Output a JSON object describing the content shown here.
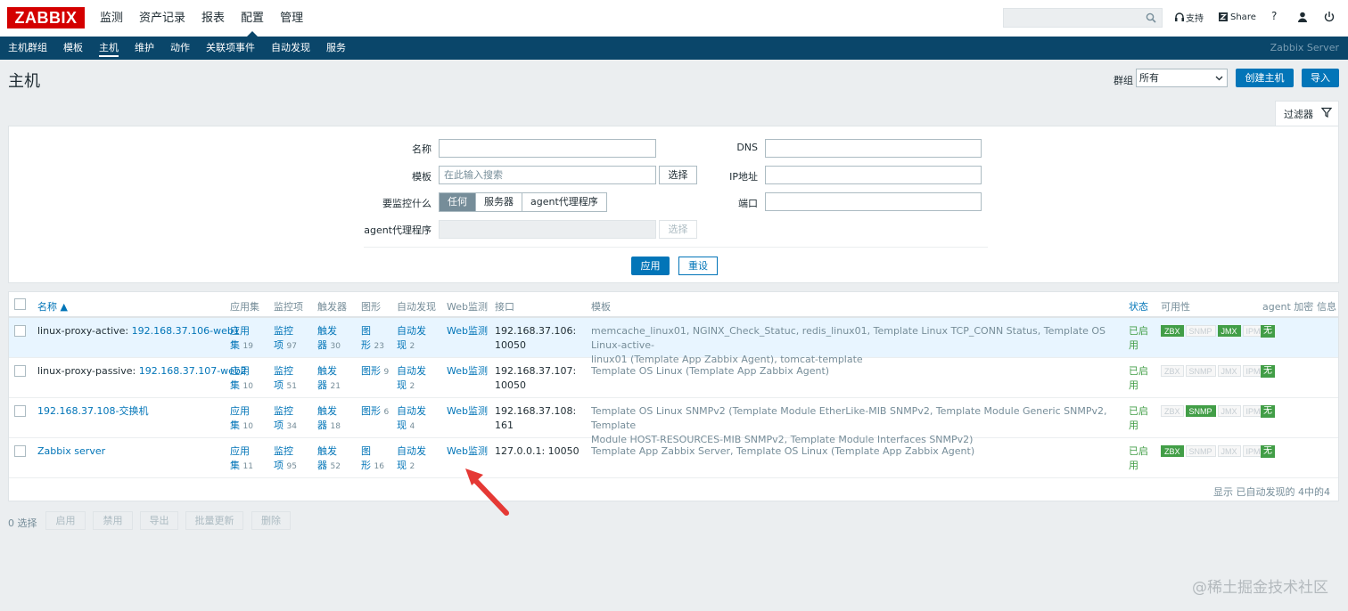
{
  "header": {
    "logo": "ZABBIX",
    "menu": [
      "监测",
      "资产记录",
      "报表",
      "配置",
      "管理"
    ],
    "active_menu": "配置",
    "search_value": "",
    "support": "支持",
    "share": "Share",
    "help": "?"
  },
  "submenu": {
    "items": [
      "主机群组",
      "模板",
      "主机",
      "维护",
      "动作",
      "关联项事件",
      "自动发现",
      "服务"
    ],
    "active": "主机",
    "server_name": "Zabbix Server"
  },
  "page": {
    "title": "主机",
    "group_label": "群组",
    "group_value": "所有",
    "create_button": "创建主机",
    "import_button": "导入"
  },
  "filter": {
    "tab_label": "过滤器",
    "name_label": "名称",
    "name_value": "",
    "template_label": "模板",
    "template_placeholder": "在此输入搜索",
    "select_button": "选择",
    "monitored_by_label": "要监控什么",
    "monitored_options": [
      "任何",
      "服务器",
      "agent代理程序"
    ],
    "monitored_selected": "任何",
    "proxy_label": "agent代理程序",
    "proxy_select_button": "选择",
    "dns_label": "DNS",
    "dns_value": "",
    "ip_label": "IP地址",
    "ip_value": "",
    "port_label": "端口",
    "port_value": "",
    "apply_button": "应用",
    "reset_button": "重设"
  },
  "table": {
    "columns": {
      "name": "名称 ▲",
      "applications": "应用集",
      "items": "监控项",
      "triggers": "触发器",
      "graphs": "图形",
      "discovery": "自动发现",
      "web": "Web监测",
      "interface": "接口",
      "templates": "模板",
      "status": "状态",
      "availability": "可用性",
      "encryption": "agent 加密",
      "info": "信息"
    },
    "rows": [
      {
        "name_prefix": "linux-proxy-active: ",
        "name_link": "192.168.37.106-web1",
        "app_a": "应用",
        "app_b": "集",
        "app_count": "19",
        "item_a": "监控",
        "item_b": "项",
        "item_count": "97",
        "trig_a": "触发",
        "trig_b": "器",
        "trig_count": "30",
        "graph_a": "图",
        "graph_b": "形",
        "graph_count": "23",
        "disc_a": "自动发",
        "disc_b": "现",
        "disc_count": "2",
        "web": "Web监测",
        "iface_a": "192.168.37.106:",
        "iface_b": "10050",
        "tpl_line1": "memcache_linux01, NGINX_Check_Statuc, redis_linux01, Template Linux TCP_CONN Status, Template OS Linux-active-",
        "tpl_line2a": "linux01 (",
        "tpl_line2b": "Template App Zabbix Agent",
        "tpl_line2c": "), tomcat-template",
        "status_a": "已启",
        "status_b": "用",
        "zbx": true,
        "snmp": false,
        "jmx": true,
        "ipmi": false,
        "encryption": "无"
      },
      {
        "name_prefix": "linux-proxy-passive: ",
        "name_link": "192.168.37.107-web2",
        "app_a": "应用",
        "app_b": "集",
        "app_count": "10",
        "item_a": "监控",
        "item_b": "项",
        "item_count": "51",
        "trig_a": "触发",
        "trig_b": "器",
        "trig_count": "21",
        "graph_a": "图形",
        "graph_b": "",
        "graph_count": "9",
        "disc_a": "自动发",
        "disc_b": "现",
        "disc_count": "2",
        "web": "Web监测",
        "iface_a": "192.168.37.107:",
        "iface_b": "10050",
        "tpl_line1": "Template OS Linux (Template App Zabbix Agent)",
        "tpl_line2a": "",
        "tpl_line2b": "",
        "tpl_line2c": "",
        "status_a": "已启",
        "status_b": "用",
        "zbx": false,
        "snmp": false,
        "jmx": false,
        "ipmi": false,
        "encryption": "无"
      },
      {
        "name_prefix": "",
        "name_link": "192.168.37.108-交换机",
        "app_a": "应用",
        "app_b": "集",
        "app_count": "10",
        "item_a": "监控",
        "item_b": "项",
        "item_count": "34",
        "trig_a": "触发",
        "trig_b": "器",
        "trig_count": "18",
        "graph_a": "图形",
        "graph_b": "",
        "graph_count": "6",
        "disc_a": "自动发",
        "disc_b": "现",
        "disc_count": "4",
        "web": "Web监测",
        "iface_a": "192.168.37.108:",
        "iface_b": "161",
        "tpl_line1": "Template OS Linux SNMPv2 (Template Module EtherLike-MIB SNMPv2, Template Module Generic SNMPv2, Template",
        "tpl_line2a": "Module HOST-RESOURCES-MIB SNMPv2, Template Module Interfaces SNMPv2)",
        "tpl_line2b": "",
        "tpl_line2c": "",
        "status_a": "已启",
        "status_b": "用",
        "zbx": false,
        "snmp": true,
        "jmx": false,
        "ipmi": false,
        "encryption": "无"
      },
      {
        "name_prefix": "",
        "name_link": "Zabbix server",
        "app_a": "应用",
        "app_b": "集",
        "app_count": "11",
        "item_a": "监控",
        "item_b": "项",
        "item_count": "95",
        "trig_a": "触发",
        "trig_b": "器",
        "trig_count": "52",
        "graph_a": "图",
        "graph_b": "形",
        "graph_count": "16",
        "disc_a": "自动发",
        "disc_b": "现",
        "disc_count": "2",
        "web": "Web监测",
        "iface_a": "127.0.0.1: 10050",
        "iface_b": "",
        "tpl_line1": "Template App Zabbix Server, Template OS Linux (Template App Zabbix Agent)",
        "tpl_line2a": "",
        "tpl_line2b": "",
        "tpl_line2c": "",
        "status_a": "已启",
        "status_b": "用",
        "zbx": true,
        "snmp": false,
        "jmx": false,
        "ipmi": false,
        "encryption": "无"
      }
    ],
    "badges": [
      "ZBX",
      "SNMP",
      "JMX",
      "IPMI"
    ],
    "footer": "显示 已自动发现的 4中的4"
  },
  "actions": {
    "selected": "0 选择",
    "buttons": [
      "启用",
      "禁用",
      "导出",
      "批量更新",
      "删除"
    ]
  },
  "watermark": "@稀土掘金技术社区",
  "colors": {
    "header_blue": "#0a466a",
    "link": "#0275b8",
    "accent_red": "#d40000",
    "green": "#429e47"
  }
}
